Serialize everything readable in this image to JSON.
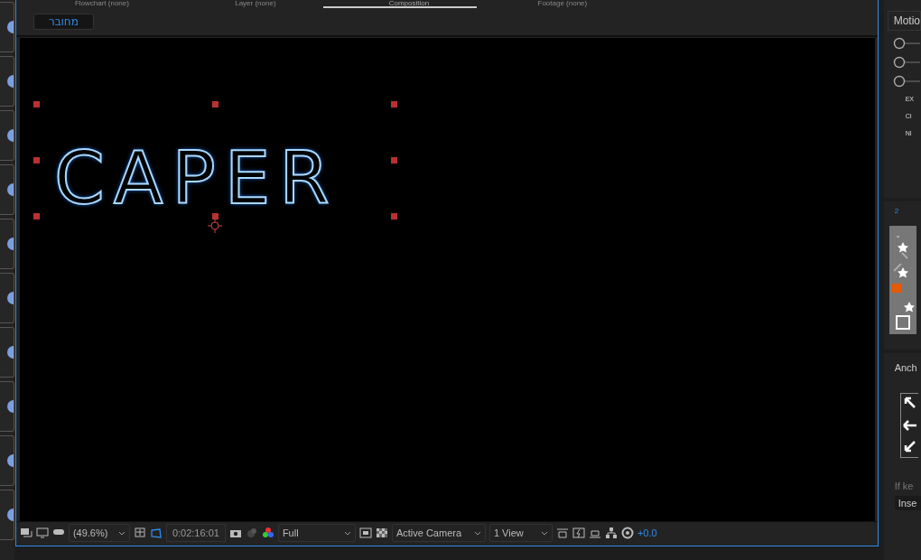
{
  "tabs": [
    {
      "label": "Flowchart (none)",
      "selected": false
    },
    {
      "label": "Layer (none)",
      "selected": false
    },
    {
      "label": "Composition",
      "selected": true
    },
    {
      "label": "Footage (none)",
      "selected": false
    }
  ],
  "comp_button": "מחובר",
  "viewer": {
    "text": "CAPER"
  },
  "toolbar": {
    "zoom": "(49.6%)",
    "timecode": "0:02:16:01",
    "resolution": "Full",
    "camera": "Active Camera",
    "views": "1 View",
    "exposure": "+0.0"
  },
  "right_panel": {
    "preset": "Motio",
    "radios": [
      {
        "selected": false
      },
      {
        "selected": false
      },
      {
        "selected": false
      }
    ],
    "actions": [
      "EX",
      "CI",
      "NI"
    ],
    "tab": "2",
    "anchor_label": "Anch",
    "hint": "If ke",
    "insert": "Inse"
  }
}
